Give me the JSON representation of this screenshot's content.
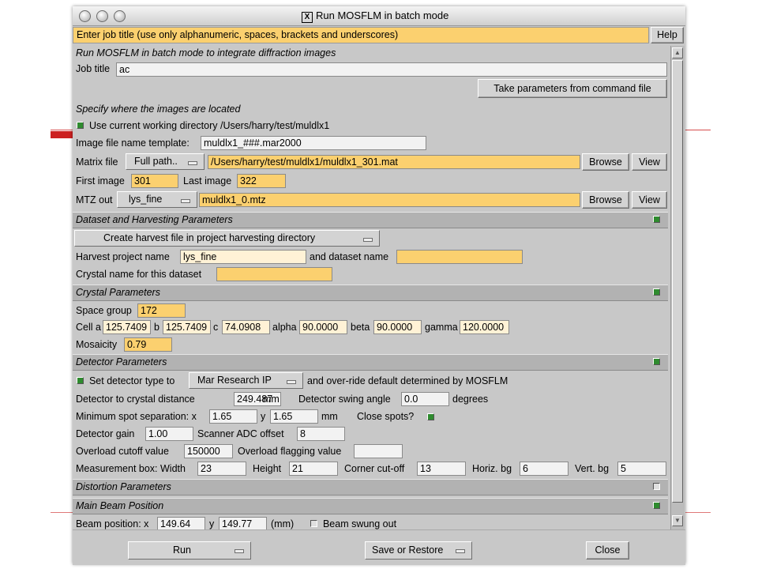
{
  "window": {
    "title": "Run MOSFLM in batch mode"
  },
  "hint": {
    "text": "Enter job title (use only alphanumeric, spaces, brackets and underscores)",
    "help_label": "Help"
  },
  "main": {
    "heading": "Run MOSFLM in batch mode to integrate diffraction images",
    "job_title_label": "Job title",
    "job_title_value": "ac",
    "take_params_label": "Take parameters from command file"
  },
  "images": {
    "heading": "Specify where the images are located",
    "use_cwd_label": "Use current working directory /Users/harry/test/muldlx1",
    "use_cwd_checked": true,
    "template_label": "Image file name template:",
    "template_value": "muldlx1_###.mar2000",
    "matrix_label": "Matrix file",
    "matrix_mode": "Full path..",
    "matrix_path": "/Users/harry/test/muldlx1/muldlx1_301.mat",
    "browse_label": "Browse",
    "view_label": "View",
    "first_label": "First image",
    "first_value": "301",
    "last_label": "Last image",
    "last_value": "322",
    "mtz_label": "MTZ out",
    "mtz_mode": "lys_fine",
    "mtz_value": "muldlx1_0.mtz"
  },
  "harvest": {
    "heading": "Dataset and Harvesting Parameters",
    "mode": "Create harvest file in project harvesting directory",
    "project_label": "Harvest project name",
    "project_value": "lys_fine",
    "dataset_label": "and dataset name",
    "dataset_value": "",
    "crystal_label": "Crystal name for this dataset",
    "crystal_value": ""
  },
  "crystal": {
    "heading": "Crystal Parameters",
    "space_group_label": "Space group",
    "space_group_value": "172",
    "cell_a_label": "Cell a",
    "cell_a": "125.7409",
    "cell_b_label": "b",
    "cell_b": "125.7409",
    "cell_c_label": "c",
    "cell_c": "74.0908",
    "alpha_label": "alpha",
    "alpha": "90.0000",
    "beta_label": "beta",
    "beta": "90.0000",
    "gamma_label": "gamma",
    "gamma": "120.0000",
    "mosaicity_label": "Mosaicity",
    "mosaicity_value": "0.79"
  },
  "detector": {
    "heading": "Detector Parameters",
    "set_type_label": "Set detector type to",
    "set_type_checked": true,
    "type_value": "Mar Research IP",
    "override_label": "and over-ride default determined by MOSFLM",
    "distance_label": "Detector to crystal distance",
    "distance_value": "249.487",
    "mm_label": "mm",
    "swing_label": "Detector swing angle",
    "swing_value": "0.0",
    "degrees_label": "degrees",
    "minsep_label": "Minimum spot separation: x",
    "minsep_x": "1.65",
    "y_label": "y",
    "minsep_y": "1.65",
    "close_label": "Close spots?",
    "close_checked": true,
    "gain_label": "Detector gain",
    "gain_value": "1.00",
    "adc_label": "Scanner ADC offset",
    "adc_value": "8",
    "overload_label": "Overload cutoff value",
    "overload_value": "150000",
    "flag_label": "Overload flagging value",
    "flag_value": "",
    "box_label": "Measurement box: Width",
    "box_width": "23",
    "height_label": "Height",
    "box_height": "21",
    "corner_label": "Corner cut-off",
    "corner_value": "13",
    "hbg_label": "Horiz. bg",
    "hbg_value": "6",
    "vbg_label": "Vert. bg",
    "vbg_value": "5"
  },
  "distortion": {
    "heading": "Distortion Parameters",
    "checked": false
  },
  "beam": {
    "heading": "Main Beam Position",
    "checked": true,
    "position_label": "Beam position: x",
    "x_value": "149.64",
    "y_label": "y",
    "y_value": "149.77",
    "unit_label": "(mm)",
    "swung_label": "Beam swung out",
    "swung_checked": false
  },
  "footer": {
    "run_label": "Run",
    "save_label": "Save or Restore",
    "close_label": "Close"
  },
  "colors": {
    "field_orange": "#fbd06f",
    "panel_grey": "#c8c8c8",
    "header_grey": "#b2b2b2",
    "check_green": "#2f8b2f"
  }
}
